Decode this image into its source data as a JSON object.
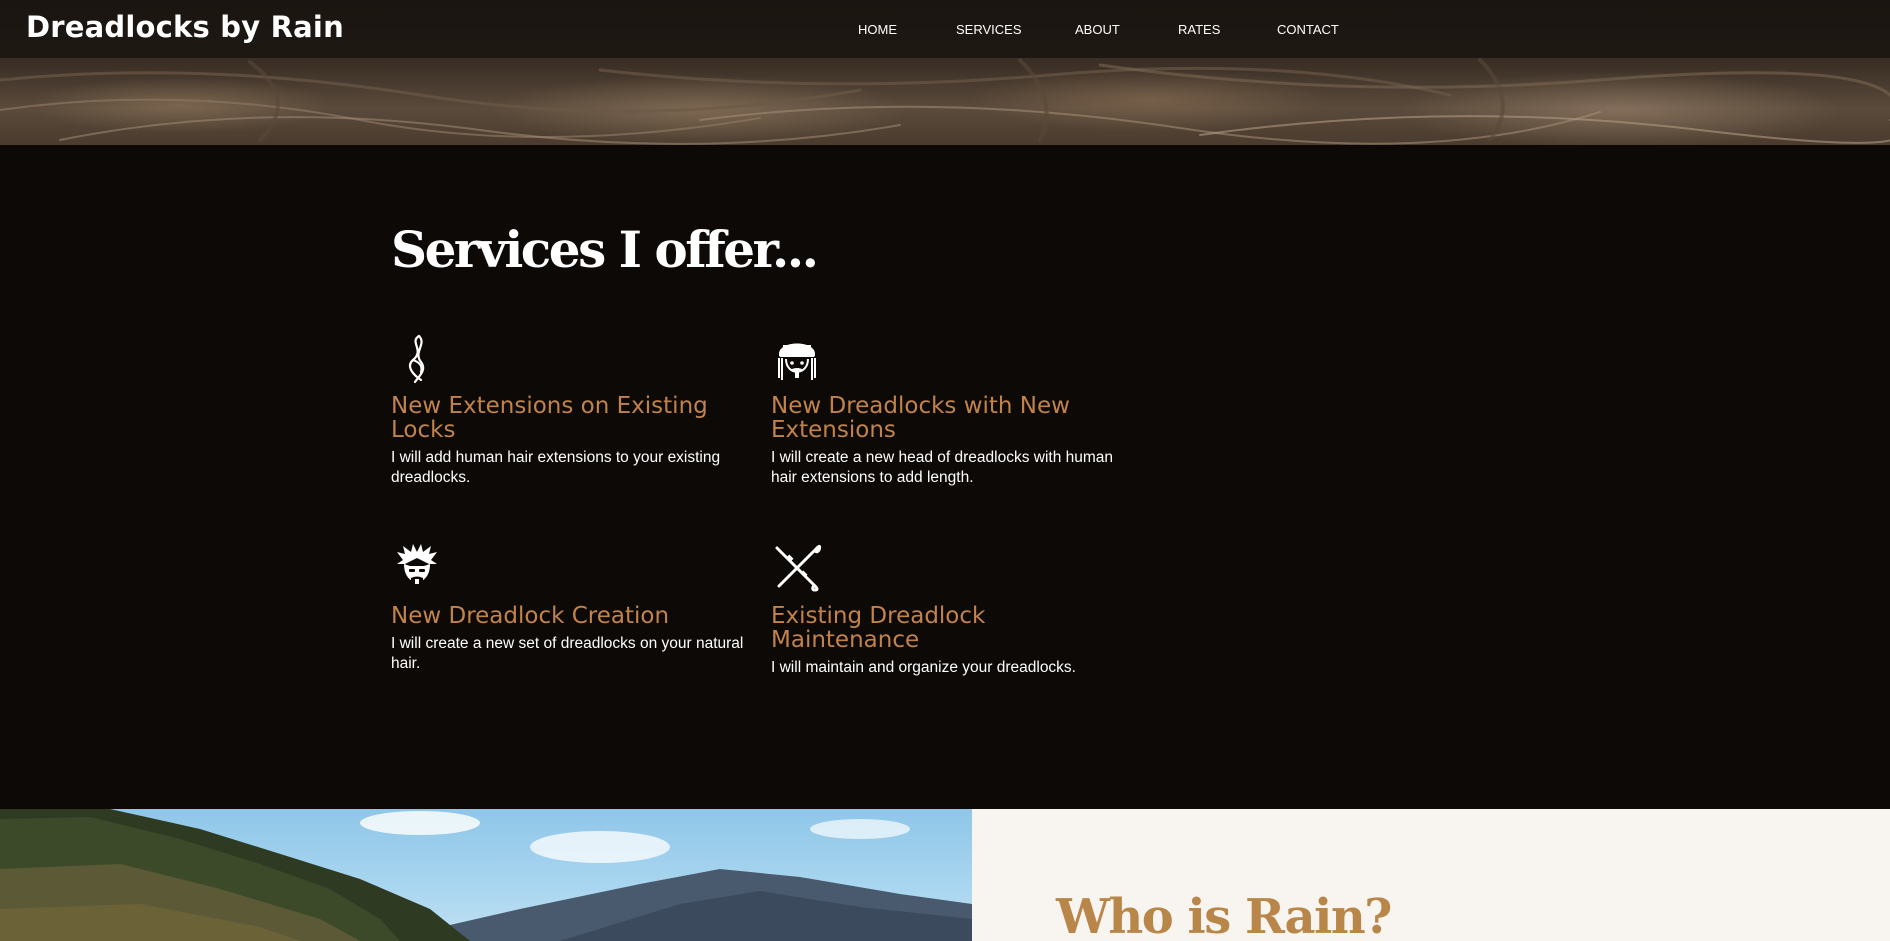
{
  "header": {
    "brand": "Dreadlocks by Rain",
    "nav": [
      "HOME",
      "SERVICES",
      "ABOUT",
      "RATES",
      "CONTACT"
    ]
  },
  "services": {
    "title": "Services I offer...",
    "items": [
      {
        "icon": "hair-strand-icon",
        "title": "New Extensions on Existing Locks",
        "description": "I will add human hair extensions to your existing dreadlocks."
      },
      {
        "icon": "dreadlocks-head-icon",
        "title": "New Dreadlocks with New Extensions",
        "description": "I will create a new head of dreadlocks with human hair extensions to add length."
      },
      {
        "icon": "spiky-hair-head-icon",
        "title": "New Dreadlock Creation",
        "description": "I will create a new set of dreadlocks on your natural hair."
      },
      {
        "icon": "crochet-hooks-icon",
        "title": "Existing Dreadlock Maintenance",
        "description": "I will maintain and organize your dreadlocks."
      }
    ]
  },
  "about": {
    "title": "Who is Rain?"
  },
  "colors": {
    "accent": "#c1834b",
    "background_dark": "#0d0906",
    "about_background": "#f8f4f0",
    "about_title": "#b98649"
  }
}
